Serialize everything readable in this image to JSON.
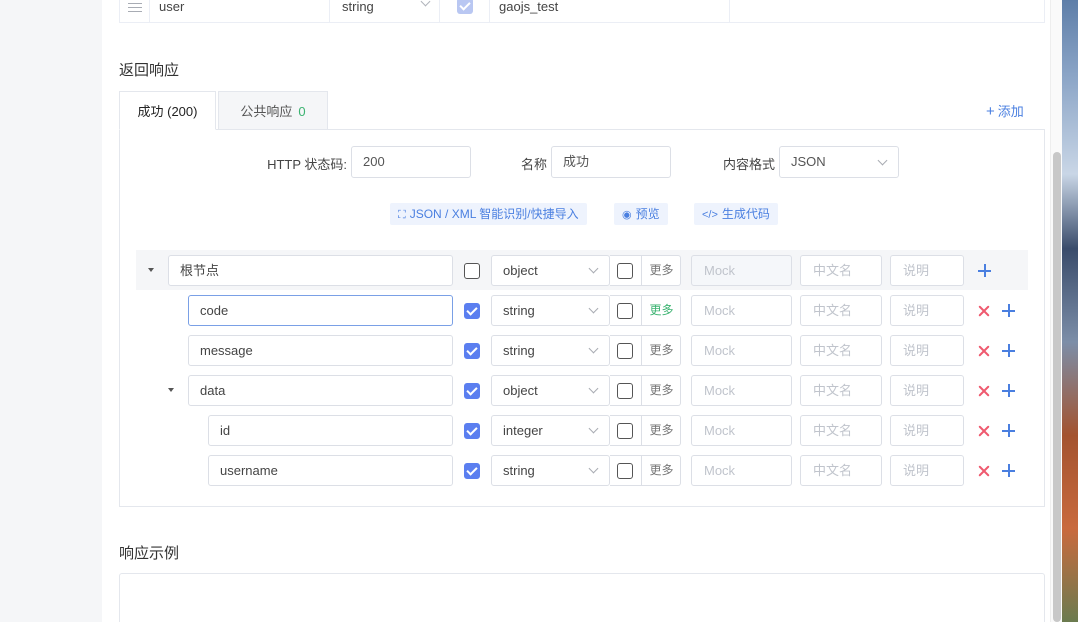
{
  "params_row": {
    "name": "user",
    "type": "string",
    "value": "gaojs_test"
  },
  "response_section": {
    "title": "返回响应",
    "tabs": [
      {
        "label": "成功 (200)"
      },
      {
        "label": "公共响应",
        "badge": "0"
      }
    ],
    "add_label": "添加",
    "form": {
      "status_label": "HTTP 状态码:",
      "status_value": "200",
      "name_label": "名称",
      "name_value": "成功",
      "format_label": "内容格式",
      "format_value": "JSON"
    },
    "toolbar": {
      "import_label": "JSON / XML 智能识别/快捷导入",
      "preview_label": "预览",
      "codegen_label": "生成代码"
    },
    "placeholders": {
      "mock": "Mock",
      "cn_name": "中文名",
      "desc": "说明"
    },
    "more_label": "更多",
    "fields": [
      {
        "name": "根节点",
        "type": "object",
        "required": false
      },
      {
        "name": "code",
        "type": "string",
        "required": true
      },
      {
        "name": "message",
        "type": "string",
        "required": true
      },
      {
        "name": "data",
        "type": "object",
        "required": true
      },
      {
        "name": "id",
        "type": "integer",
        "required": true
      },
      {
        "name": "username",
        "type": "string",
        "required": true
      }
    ]
  },
  "example_section": {
    "title": "响应示例"
  },
  "colors": {
    "accent": "#4a7fe0",
    "checkbox": "#5b7ff0",
    "success": "#3cb371",
    "danger": "#ef5a6f"
  }
}
